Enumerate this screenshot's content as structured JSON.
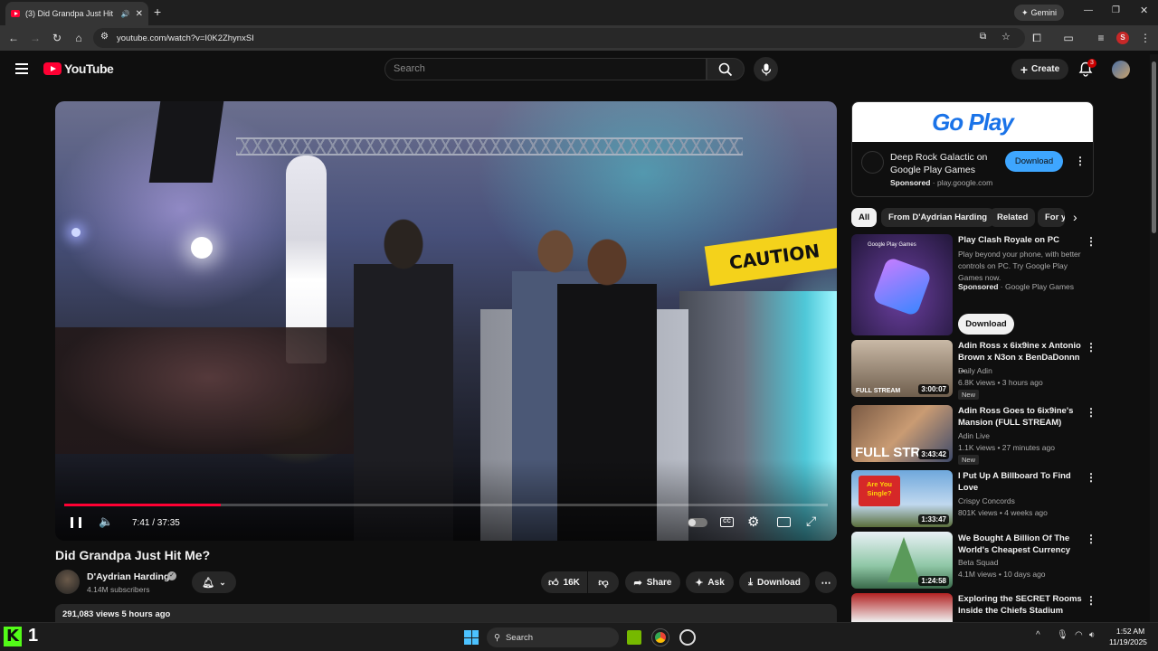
{
  "browser": {
    "tab_title": "(3) Did Grandpa Just Hit Me?",
    "url": "youtube.com/watch?v=I0K2ZhynxSI",
    "gemini_label": "Gemini",
    "profile_initial": "S"
  },
  "header": {
    "logo_text": "YouTube",
    "search_placeholder": "Search",
    "create_label": "Create",
    "notification_count": "3"
  },
  "player": {
    "current_time": "7:41 / 37:35",
    "progress": 0.205
  },
  "video": {
    "title": "Did Grandpa Just Hit Me?",
    "channel": "D'Aydrian Harding",
    "subscribers": "4.14M subscribers",
    "likes": "16K",
    "share_label": "Share",
    "ask_label": "Ask",
    "download_label": "Download",
    "views_line": "291,083 views  5 hours ago"
  },
  "ad": {
    "banner_text": "Go Play",
    "title": "Deep Rock Galactic on Google Play Games",
    "sponsored": "Sponsored",
    "domain": "play.google.com",
    "cta": "Download"
  },
  "chips": [
    "All",
    "From D'Aydrian Harding",
    "Related",
    "For y"
  ],
  "sponsored_rec": {
    "title": "Play Clash Royale on PC",
    "body": "Play beyond your phone, with better controls on PC. Try Google Play Games now.",
    "sponsored": "Sponsored",
    "advertiser": "Google Play Games",
    "cta": "Download",
    "thumb_label": "Google Play Games"
  },
  "recommendations": [
    {
      "title": "Adin Ross x 6ix9ine x Antonio Brown x N3on x BenDaDonnn ...",
      "channel": "Daily Adin",
      "meta": "6.8K views • 3 hours ago",
      "badge": "New",
      "duration": "3:00:07",
      "thumb_text": "FULL STREAM"
    },
    {
      "title": "Adin Ross Goes to 6ix9ine's Mansion (FULL STREAM)",
      "channel": "Adin Live",
      "meta": "1.1K views • 27 minutes ago",
      "badge": "New",
      "duration": "3:43:42",
      "thumb_text": "FULL STR"
    },
    {
      "title": "I Put Up A Billboard To Find Love",
      "channel": "Crispy Concords",
      "meta": "801K views • 4 weeks ago",
      "badge": "",
      "duration": "1:33:47",
      "thumb_text": "Are You Single?"
    },
    {
      "title": "We Bought A Billion Of The World's Cheapest Currency",
      "channel": "Beta Squad",
      "meta": "4.1M views • 10 days ago",
      "badge": "",
      "duration": "1:24:58",
      "thumb_text": ""
    },
    {
      "title": "Exploring the SECRET Rooms Inside the Chiefs Stadium",
      "channel": "",
      "meta": "",
      "badge": "",
      "duration": "",
      "thumb_text": ""
    }
  ],
  "taskbar": {
    "search_label": "Search",
    "time": "1:52 AM",
    "date": "11/19/2025",
    "app_badge": "1"
  },
  "colors": {
    "yt_red": "#ff0033",
    "download_blue": "#3ea6ff",
    "bg": "#0f0f0f"
  }
}
